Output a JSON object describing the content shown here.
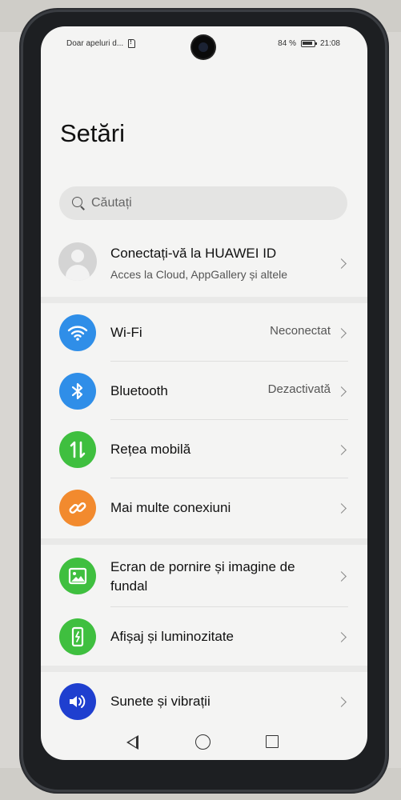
{
  "status_bar": {
    "carrier_text": "Doar apeluri d...",
    "battery_percent": "84 %",
    "time": "21:08"
  },
  "page_title": "Setări",
  "search": {
    "placeholder": "Căutați"
  },
  "account": {
    "title": "Conectați-vă la HUAWEI ID",
    "subtitle": "Acces la Cloud, AppGallery și altele"
  },
  "items": [
    {
      "label": "Wi-Fi",
      "value": "Neconectat",
      "icon": "wifi-icon",
      "color": "#2f8ee8"
    },
    {
      "label": "Bluetooth",
      "value": "Dezactivată",
      "icon": "bluetooth-icon",
      "color": "#2f8ee8"
    },
    {
      "label": "Rețea mobilă",
      "value": "",
      "icon": "mobile-data-icon",
      "color": "#3fbf3f"
    },
    {
      "label": "Mai multe conexiuni",
      "value": "",
      "icon": "link-icon",
      "color": "#f28a2e"
    },
    {
      "label": "Ecran de pornire și imagine de",
      "label2": "fundal",
      "value": "",
      "icon": "wallpaper-icon",
      "color": "#3fbf3f"
    },
    {
      "label": "Afișaj și luminozitate",
      "value": "",
      "icon": "display-icon",
      "color": "#3fbf3f"
    },
    {
      "label": "Sunete și vibrații",
      "value": "",
      "icon": "speaker-icon",
      "color": "#1f3fcf"
    }
  ]
}
